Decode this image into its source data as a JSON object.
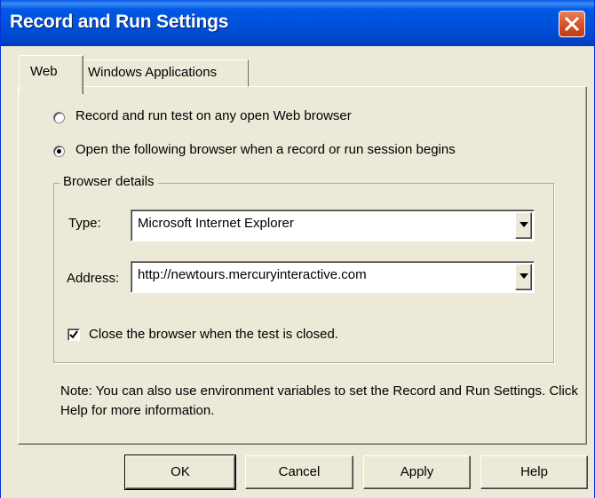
{
  "window": {
    "title": "Record and Run Settings",
    "close_icon": "close-icon"
  },
  "tabs": [
    {
      "label": "Web",
      "selected": true
    },
    {
      "label": "Windows Applications",
      "selected": false
    }
  ],
  "options": {
    "radio_any_browser": "Record and run test on any open Web browser",
    "radio_open_browser": "Open the following browser when a record or run session begins",
    "selected": "radio_open_browser"
  },
  "browser_details": {
    "title": "Browser details",
    "type_label": "Type:",
    "type_value": "Microsoft Internet Explorer",
    "address_label": "Address:",
    "address_value": "http://newtours.mercuryinteractive.com",
    "close_checkbox_label": "Close the browser when the test is closed.",
    "close_checkbox_checked": true
  },
  "note": "Note: You can also use environment variables to set the Record and Run Settings.  Click Help for more information.",
  "buttons": {
    "ok": "OK",
    "cancel": "Cancel",
    "apply": "Apply",
    "help": "Help"
  },
  "colors": {
    "titlebar": "#0054e3",
    "dialog_bg": "#ece9d8",
    "close_button": "#d8542a"
  }
}
